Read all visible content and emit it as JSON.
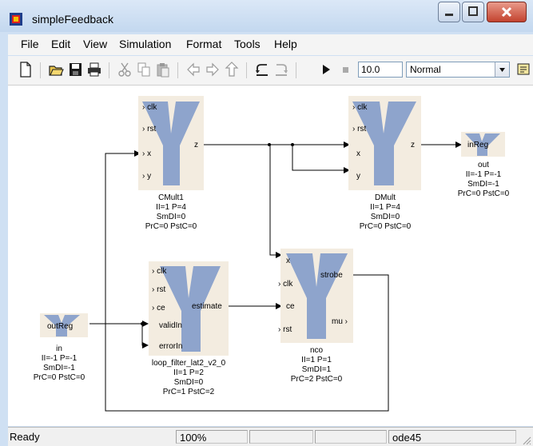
{
  "window": {
    "title": "simpleFeedback"
  },
  "menu": [
    "File",
    "Edit",
    "View",
    "Simulation",
    "Format",
    "Tools",
    "Help"
  ],
  "toolbar": {
    "stop_time": "10.0",
    "sim_mode": "Normal"
  },
  "blocks": {
    "cmult1": {
      "name": "CMult1",
      "ports_in": [
        "clk",
        "rst",
        "x",
        "y"
      ],
      "ports_out": [
        "z"
      ],
      "info": [
        "II=1 P=4",
        "SmDI=0",
        "PrC=0 PstC=0"
      ]
    },
    "dmult": {
      "name": "DMult",
      "ports_in": [
        "clk",
        "rst",
        "x",
        "y"
      ],
      "ports_out": [
        "z"
      ],
      "info": [
        "II=1 P=4",
        "SmDI=0",
        "PrC=0 PstC=0"
      ]
    },
    "out": {
      "name": "out",
      "ports_in": [
        "inReg"
      ],
      "info": [
        "II=-1 P=-1",
        "SmDI=-1",
        "PrC=0 PstC=0"
      ]
    },
    "in": {
      "name": "in",
      "ports_out": [
        "outReg"
      ],
      "info": [
        "II=-1 P=-1",
        "SmDI=-1",
        "PrC=0 PstC=0"
      ]
    },
    "loop_filter": {
      "name": "loop_filter_lat2_v2_0",
      "ports_in": [
        "clk",
        "rst",
        "ce",
        "validIn",
        "errorIn"
      ],
      "ports_out": [
        "estimate"
      ],
      "info": [
        "II=1 P=2",
        "SmDI=0",
        "PrC=1 PstC=2"
      ]
    },
    "nco": {
      "name": "nco",
      "ports_in": [
        "x",
        "clk",
        "ce",
        "rst"
      ],
      "ports_out": [
        "strobe",
        "mu"
      ],
      "info": [
        "II=1 P=1",
        "SmDI=1",
        "PrC=2 PstC=0"
      ]
    }
  },
  "status": {
    "text": "Ready",
    "zoom": "100%",
    "solver": "ode45"
  },
  "colors": {
    "block_bg": "#f3ece0",
    "block_glyph": "#8ea4cc",
    "title_bg": "#cfe0f3"
  }
}
